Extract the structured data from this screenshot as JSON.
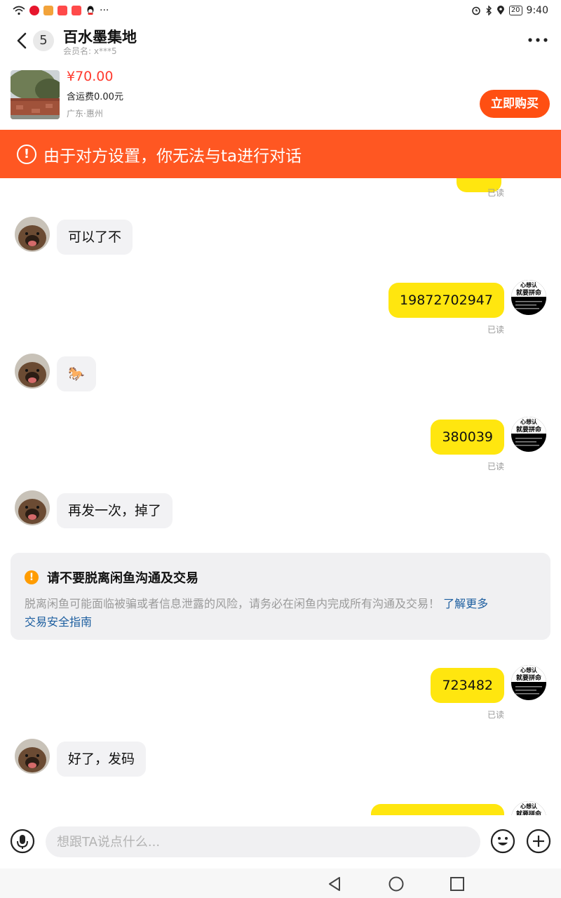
{
  "status_bar": {
    "time": "9:40",
    "battery": "20",
    "more": "···"
  },
  "header": {
    "back_count": "5",
    "title": "百水墨集地",
    "subtitle": "会员名: x***5"
  },
  "product": {
    "price": "¥70.00",
    "shipping": "含运费0.00元",
    "location": "广东·惠州",
    "buy_label": "立即购买"
  },
  "alert": {
    "icon": "!",
    "text": "由于对方设置，你无法与ta进行对话"
  },
  "chat": {
    "read_label": "已读",
    "messages": [
      {
        "side": "right",
        "text": ""
      },
      {
        "side": "left",
        "text": "可以了不"
      },
      {
        "side": "right",
        "text": "19872702947"
      },
      {
        "side": "left",
        "text": "🐎"
      },
      {
        "side": "right",
        "text": "380039"
      },
      {
        "side": "left",
        "text": "再发一次，掉了"
      },
      {
        "side": "right",
        "text": "723482"
      },
      {
        "side": "left",
        "text": "好了，发码"
      },
      {
        "side": "right",
        "text": ""
      }
    ],
    "notice": {
      "icon": "!",
      "title": "请不要脱离闲鱼沟通及交易",
      "body": "脱离闲鱼可能面临被骗或者信息泄露的风险，请务必在闲鱼内完成所有沟通及交易！",
      "link1": "了解更多",
      "link2": "交易安全指南"
    },
    "avatar_right_text": {
      "line1": "心想认",
      "line2": "就要拼命"
    }
  },
  "input": {
    "placeholder": "想跟TA说点什么..."
  },
  "colors": {
    "accent": "#ff4f12",
    "banner": "#ff5722",
    "my_bubble": "#ffe60f",
    "their_bubble": "#f2f2f4",
    "price": "#ff3b2f",
    "link": "#1e5fa0"
  },
  "icons": [
    "wifi-icon",
    "weibo-icon",
    "back-chevron-icon",
    "more-dots-icon",
    "alert-circle-icon",
    "warning-icon",
    "mic-icon",
    "emoji-icon",
    "plus-icon",
    "nav-back-icon",
    "nav-home-icon",
    "nav-recent-icon"
  ]
}
